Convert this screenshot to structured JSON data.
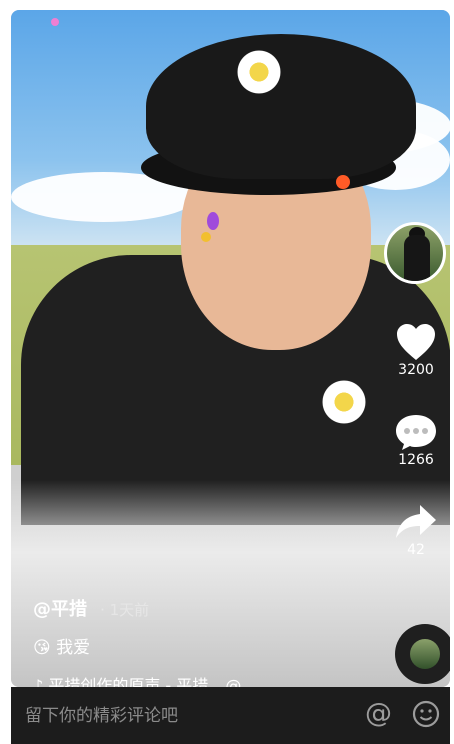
{
  "overlay": {
    "likes": "3200",
    "comments": "1266",
    "shares": "42"
  },
  "caption": {
    "author": "@平措",
    "time": "· 1天前",
    "emoji": "😘",
    "text": "我爱",
    "music_icon": "♪",
    "music": "平措创作的原声 - 平措",
    "mention_icon": "@"
  },
  "comment_bar": {
    "placeholder": "留下你的精彩评论吧",
    "at_icon": "@",
    "emoji_icon": "emoji-face-icon"
  }
}
